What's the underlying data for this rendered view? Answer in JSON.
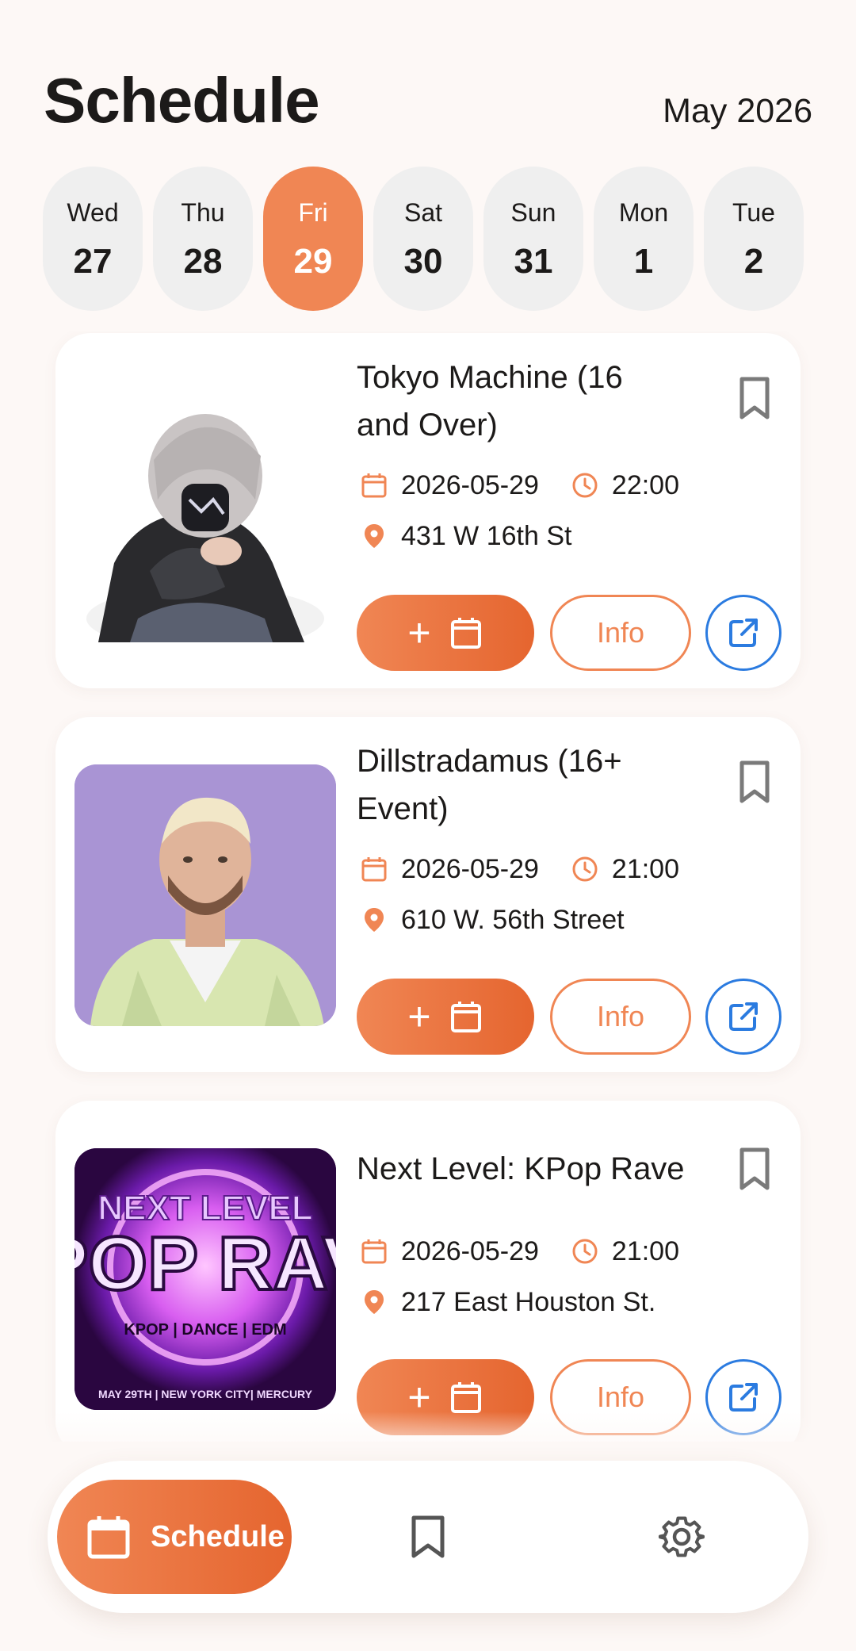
{
  "header": {
    "title": "Schedule",
    "month": "May 2026"
  },
  "days": [
    {
      "name": "Wed",
      "num": "27",
      "active": false
    },
    {
      "name": "Thu",
      "num": "28",
      "active": false
    },
    {
      "name": "Fri",
      "num": "29",
      "active": true
    },
    {
      "name": "Sat",
      "num": "30",
      "active": false
    },
    {
      "name": "Sun",
      "num": "31",
      "active": false
    },
    {
      "name": "Mon",
      "num": "1",
      "active": false
    },
    {
      "name": "Tue",
      "num": "2",
      "active": false
    }
  ],
  "events": [
    {
      "title": "Tokyo Machine (16 and Over)",
      "date": "2026-05-29",
      "time": "22:00",
      "address": "431 W 16th St",
      "add_label": "+",
      "info_label": "Info"
    },
    {
      "title": "Dillstradamus (16+ Event)",
      "date": "2026-05-29",
      "time": "21:00",
      "address": "610 W. 56th Street",
      "add_label": "+",
      "info_label": "Info"
    },
    {
      "title": "Next Level: KPop Rave",
      "date": "2026-05-29",
      "time": "21:00",
      "address": "217 East Houston St.",
      "add_label": "+",
      "info_label": "Info",
      "poster_text": {
        "line1": "NEXT LEVEL",
        "line2": "POP RAV",
        "line3": "KPOP | DANCE | EDM",
        "line4": "MAY 29TH | NEW YORK CITY| MERCURY"
      }
    }
  ],
  "nav": {
    "schedule_label": "Schedule"
  },
  "colors": {
    "accent": "#f08654",
    "accent_dark": "#e5652f",
    "link_blue": "#2b7be0",
    "background": "#fdf8f6"
  }
}
